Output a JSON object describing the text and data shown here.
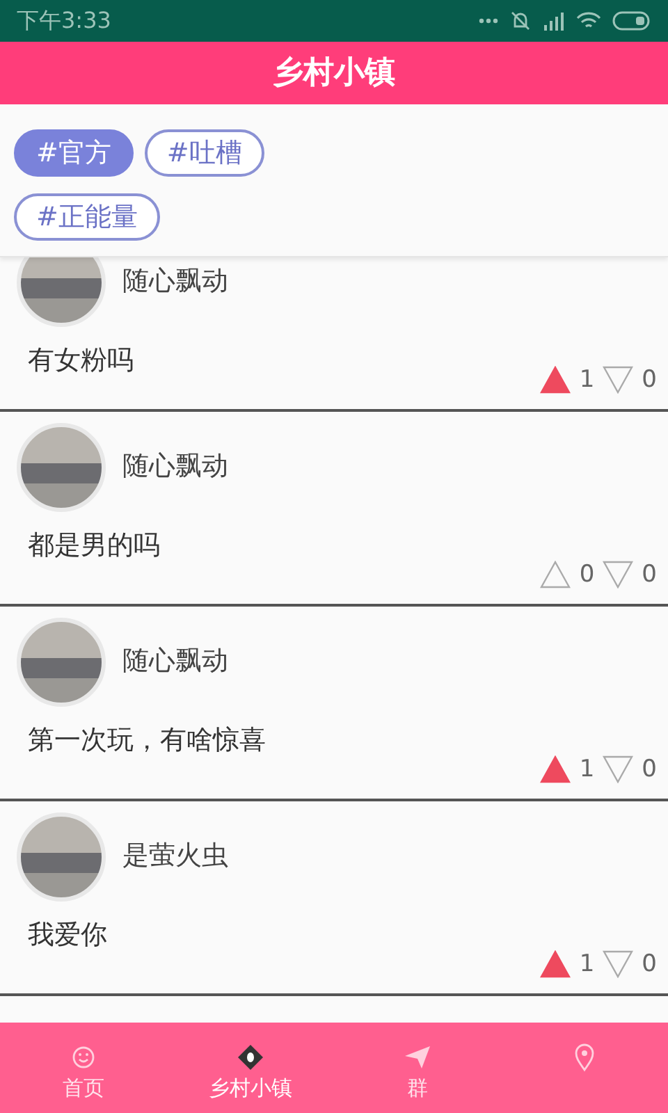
{
  "status_bar": {
    "time": "下午3:33"
  },
  "header": {
    "title": "乡村小镇"
  },
  "tags": [
    {
      "label": "#官方",
      "selected": true
    },
    {
      "label": "#吐槽",
      "selected": false
    },
    {
      "label": "#正能量",
      "selected": false
    }
  ],
  "posts": [
    {
      "author": "随心飘动",
      "text": "有女粉吗",
      "up_voted": true,
      "up_count": "1",
      "down_voted": false,
      "down_count": "0"
    },
    {
      "author": "随心飘动",
      "text": "都是男的吗",
      "up_voted": false,
      "up_count": "0",
      "down_voted": false,
      "down_count": "0"
    },
    {
      "author": "随心飘动",
      "text": "第一次玩，有啥惊喜",
      "up_voted": true,
      "up_count": "1",
      "down_voted": false,
      "down_count": "0"
    },
    {
      "author": "是萤火虫",
      "text": "我爱你",
      "up_voted": true,
      "up_count": "1",
      "down_voted": false,
      "down_count": "0"
    }
  ],
  "bottom_nav": [
    {
      "kind": "smile",
      "label": "首页",
      "selected": false
    },
    {
      "kind": "eye",
      "label": "乡村小镇",
      "selected": true
    },
    {
      "kind": "plane",
      "label": "群",
      "selected": false
    },
    {
      "kind": "pin",
      "selected": false
    }
  ]
}
